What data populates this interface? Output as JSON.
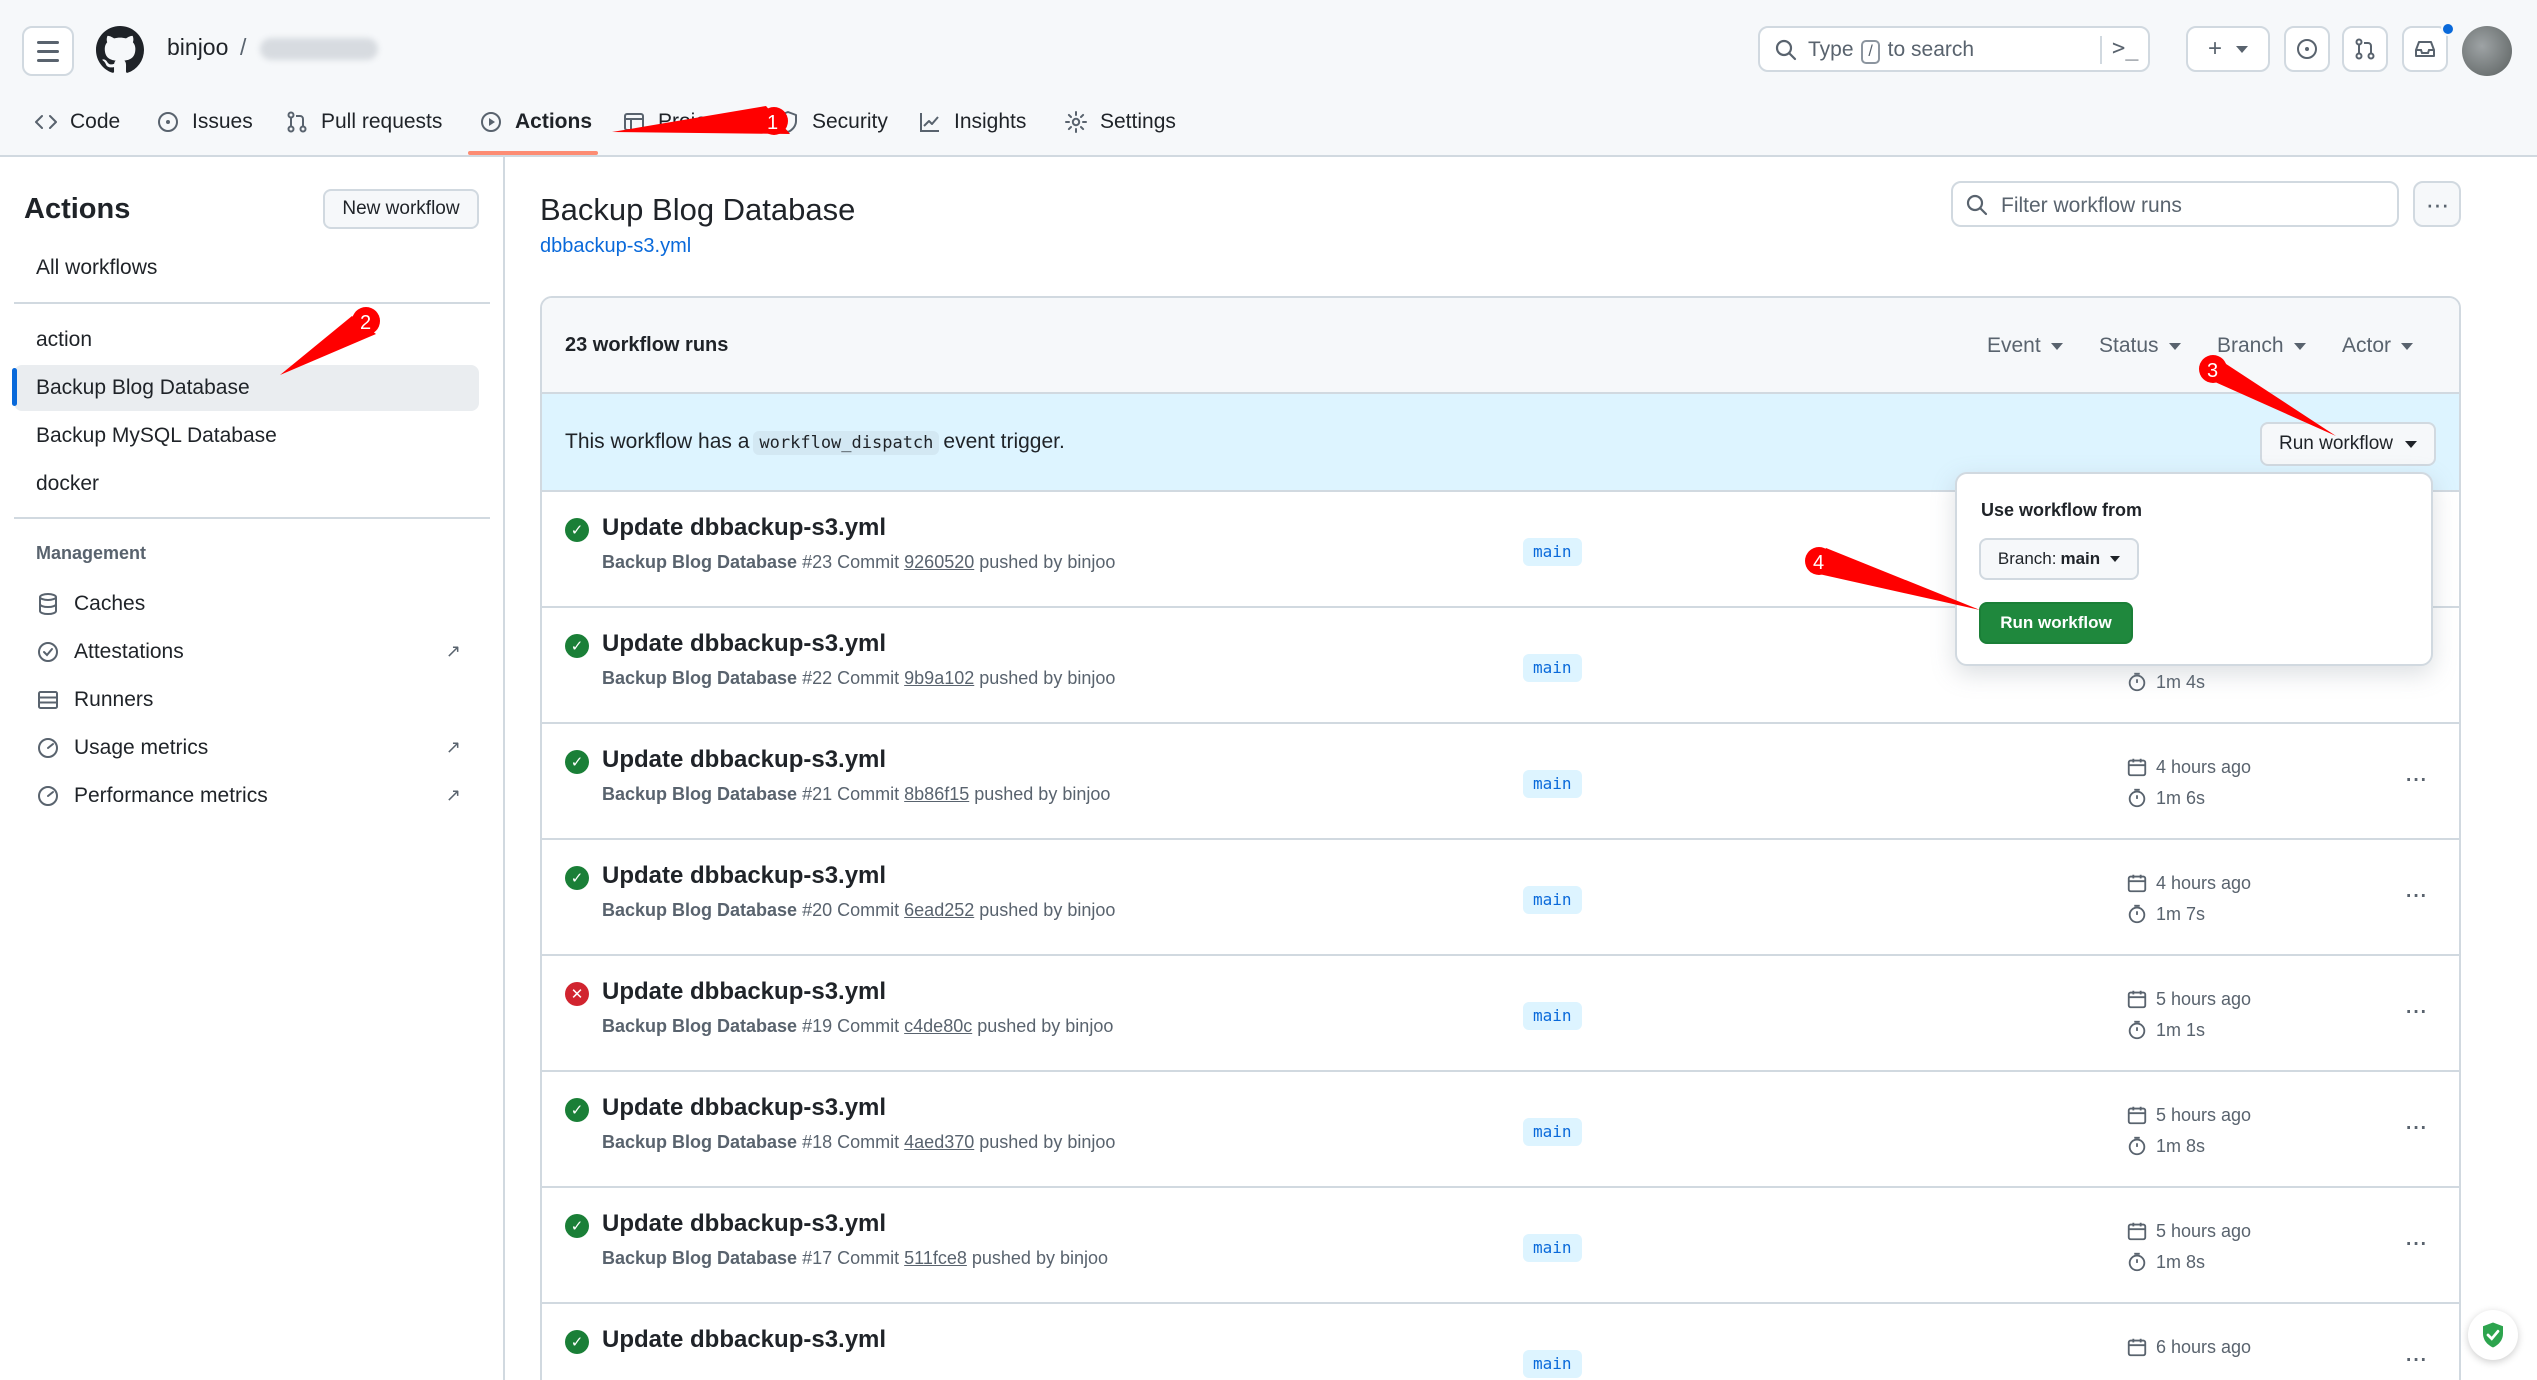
{
  "header": {
    "owner": "binjoo",
    "separator": "/",
    "search": {
      "prefix": "Type",
      "key": "/",
      "suffix": "to search"
    }
  },
  "tabs": [
    {
      "label": "Code",
      "icon": "code-icon"
    },
    {
      "label": "Issues",
      "icon": "issue-icon"
    },
    {
      "label": "Pull requests",
      "icon": "pull-request-icon"
    },
    {
      "label": "Actions",
      "icon": "play-icon",
      "active": true
    },
    {
      "label": "Projects",
      "icon": "table-icon"
    },
    {
      "label": "Security",
      "icon": "shield-icon"
    },
    {
      "label": "Insights",
      "icon": "graph-icon"
    },
    {
      "label": "Settings",
      "icon": "gear-icon"
    }
  ],
  "sidebar": {
    "title": "Actions",
    "new_workflow": "New workflow",
    "all_workflows": "All workflows",
    "workflows": [
      {
        "label": "action"
      },
      {
        "label": "Backup Blog Database",
        "active": true
      },
      {
        "label": "Backup MySQL Database"
      },
      {
        "label": "docker"
      }
    ],
    "management_heading": "Management",
    "management": [
      {
        "label": "Caches",
        "icon": "database-icon",
        "external": false
      },
      {
        "label": "Attestations",
        "icon": "verified-icon",
        "external": true
      },
      {
        "label": "Runners",
        "icon": "server-icon",
        "external": false
      },
      {
        "label": "Usage metrics",
        "icon": "meter-icon",
        "external": true
      },
      {
        "label": "Performance metrics",
        "icon": "meter-icon",
        "external": true
      }
    ],
    "external_glyph": "↗"
  },
  "main": {
    "title": "Backup Blog Database",
    "file": "dbbackup-s3.yml",
    "filter_placeholder": "Filter workflow runs",
    "runs_count": "23 workflow runs",
    "filters": [
      "Event",
      "Status",
      "Branch",
      "Actor"
    ],
    "dispatch": {
      "prefix": "This workflow has a",
      "code": "workflow_dispatch",
      "suffix": "event trigger."
    },
    "run_workflow_label": "Run workflow",
    "runs": [
      {
        "status": "success",
        "title": "Update dbbackup-s3.yml",
        "workflow": "Backup Blog Database",
        "number": "#23",
        "commit_label": "Commit",
        "sha": "9260520",
        "pushed_by": "pushed by binjoo",
        "branch": "main",
        "time": "",
        "duration": ""
      },
      {
        "status": "success",
        "title": "Update dbbackup-s3.yml",
        "workflow": "Backup Blog Database",
        "number": "#22",
        "commit_label": "Commit",
        "sha": "9b9a102",
        "pushed_by": "pushed by binjoo",
        "branch": "main",
        "time": "",
        "duration": "1m 4s"
      },
      {
        "status": "success",
        "title": "Update dbbackup-s3.yml",
        "workflow": "Backup Blog Database",
        "number": "#21",
        "commit_label": "Commit",
        "sha": "8b86f15",
        "pushed_by": "pushed by binjoo",
        "branch": "main",
        "time": "4 hours ago",
        "duration": "1m 6s"
      },
      {
        "status": "success",
        "title": "Update dbbackup-s3.yml",
        "workflow": "Backup Blog Database",
        "number": "#20",
        "commit_label": "Commit",
        "sha": "6ead252",
        "pushed_by": "pushed by binjoo",
        "branch": "main",
        "time": "4 hours ago",
        "duration": "1m 7s"
      },
      {
        "status": "failure",
        "title": "Update dbbackup-s3.yml",
        "workflow": "Backup Blog Database",
        "number": "#19",
        "commit_label": "Commit",
        "sha": "c4de80c",
        "pushed_by": "pushed by binjoo",
        "branch": "main",
        "time": "5 hours ago",
        "duration": "1m 1s"
      },
      {
        "status": "success",
        "title": "Update dbbackup-s3.yml",
        "workflow": "Backup Blog Database",
        "number": "#18",
        "commit_label": "Commit",
        "sha": "4aed370",
        "pushed_by": "pushed by binjoo",
        "branch": "main",
        "time": "5 hours ago",
        "duration": "1m 8s"
      },
      {
        "status": "success",
        "title": "Update dbbackup-s3.yml",
        "workflow": "Backup Blog Database",
        "number": "#17",
        "commit_label": "Commit",
        "sha": "511fce8",
        "pushed_by": "pushed by binjoo",
        "branch": "main",
        "time": "5 hours ago",
        "duration": "1m 8s"
      },
      {
        "status": "success",
        "title": "Update dbbackup-s3.yml",
        "workflow": "",
        "number": "",
        "commit_label": "",
        "sha": "",
        "pushed_by": "",
        "branch": "main",
        "time": "6 hours ago",
        "duration": ""
      }
    ]
  },
  "popover": {
    "title": "Use workflow from",
    "branch_prefix": "Branch:",
    "branch_value": "main",
    "run_label": "Run workflow"
  },
  "annotations": [
    "1",
    "2",
    "3",
    "4"
  ],
  "colors": {
    "accent": "#0969da",
    "success": "#1a7f37",
    "failure": "#d1242f",
    "tab_underline": "#fd8c73",
    "annotation": "#ff0000",
    "run_button": "#1f883d"
  }
}
